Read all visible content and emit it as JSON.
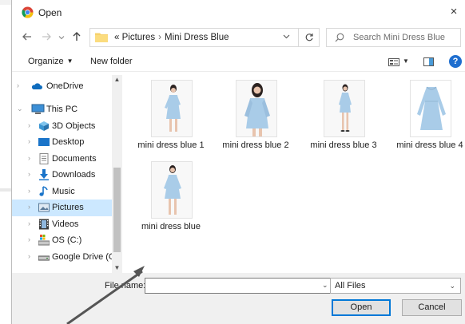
{
  "dialog": {
    "title": "Open",
    "close_glyph": "×"
  },
  "address": {
    "overflow_glyph": "«",
    "path": [
      "Pictures",
      "Mini Dress Blue"
    ],
    "separator": "›",
    "search_placeholder": "Search Mini Dress Blue"
  },
  "toolbar": {
    "organize_label": "Organize",
    "new_folder_label": "New folder",
    "help_glyph": "?"
  },
  "sidebar": {
    "items": [
      {
        "label": "OneDrive",
        "icon": "cloud-icon"
      },
      {
        "label": "This PC",
        "icon": "computer-icon"
      },
      {
        "label": "3D Objects",
        "icon": "cube-icon"
      },
      {
        "label": "Desktop",
        "icon": "desktop-icon"
      },
      {
        "label": "Documents",
        "icon": "document-icon"
      },
      {
        "label": "Downloads",
        "icon": "download-icon"
      },
      {
        "label": "Music",
        "icon": "music-icon"
      },
      {
        "label": "Pictures",
        "icon": "pictures-icon",
        "selected": true
      },
      {
        "label": "Videos",
        "icon": "film-icon"
      },
      {
        "label": "OS (C:)",
        "icon": "drive-icon"
      },
      {
        "label": "Google Drive (G:",
        "icon": "drive-icon"
      }
    ]
  },
  "files": [
    {
      "name": "mini dress blue 1"
    },
    {
      "name": "mini dress blue 2"
    },
    {
      "name": "mini dress blue 3"
    },
    {
      "name": "mini dress blue 4"
    },
    {
      "name": "mini dress blue"
    }
  ],
  "footer": {
    "filename_label": "File name:",
    "filename_value": "",
    "filetype_value": "All Files",
    "open_label": "Open",
    "cancel_label": "Cancel"
  },
  "colors": {
    "accent": "#0078d7",
    "selection": "#cce8ff",
    "dress": "#a9cce8",
    "folder": "#f6d16b"
  }
}
